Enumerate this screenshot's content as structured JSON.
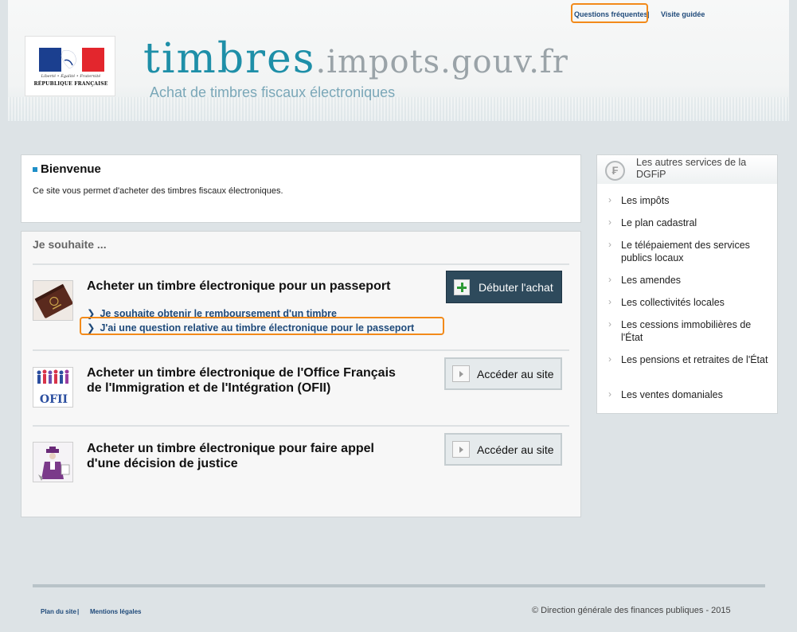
{
  "header": {
    "top_links": {
      "faq": "Questions fréquentes",
      "separator": "|",
      "visit": "Visite guidée"
    },
    "logo": {
      "motto": "Liberté • Égalité • Fraternité",
      "republic": "RÉPUBLIQUE FRANÇAISE"
    },
    "brand": {
      "part1": "timbres",
      "part2": ".impots.gouv.fr"
    },
    "tagline": "Achat de timbres fiscaux électroniques"
  },
  "welcome": {
    "title": "Bienvenue",
    "text": "Ce site vous permet d'acheter des timbres fiscaux électroniques."
  },
  "wish": {
    "title": "Je souhaite ...",
    "items": [
      {
        "title": "Acheter un timbre électronique pour un passeport",
        "icon": "passport-icon",
        "button": "Débuter l'achat",
        "links": [
          "Je souhaite obtenir le remboursement d'un timbre",
          "J'ai une question relative au timbre électronique pour le passeport"
        ]
      },
      {
        "title_line1": "Acheter un timbre électronique de l'Office Français",
        "title_line2": "de l'Immigration et de l'Intégration (OFII)",
        "icon": "ofii-icon",
        "icon_text": "OFII",
        "button": "Accéder au site"
      },
      {
        "title_line1": "Acheter un timbre électronique pour faire appel",
        "title_line2": "d'une décision de justice",
        "icon": "justice-icon",
        "button": "Accéder au site"
      }
    ]
  },
  "side": {
    "title": "Les autres services de la DGFiP",
    "icon_glyph": "₣",
    "items": [
      "Les impôts",
      "Le plan cadastral",
      "Le télépaiement des services publics locaux",
      "Les amendes",
      "Les collectivités locales",
      "Les cessions immobilières de l'État",
      "Les pensions et retraites de l'État",
      "Les ventes domaniales"
    ]
  },
  "footer": {
    "sitemap": "Plan du site",
    "separator": "|",
    "legal": "Mentions légales",
    "copyright": "© Direction générale des finances publiques - 2015"
  },
  "colors": {
    "brand_teal": "#1e8fa8",
    "link_blue": "#1f4a7a",
    "highlight_orange": "#f28a1a",
    "dark_button": "#2e4a5c"
  }
}
